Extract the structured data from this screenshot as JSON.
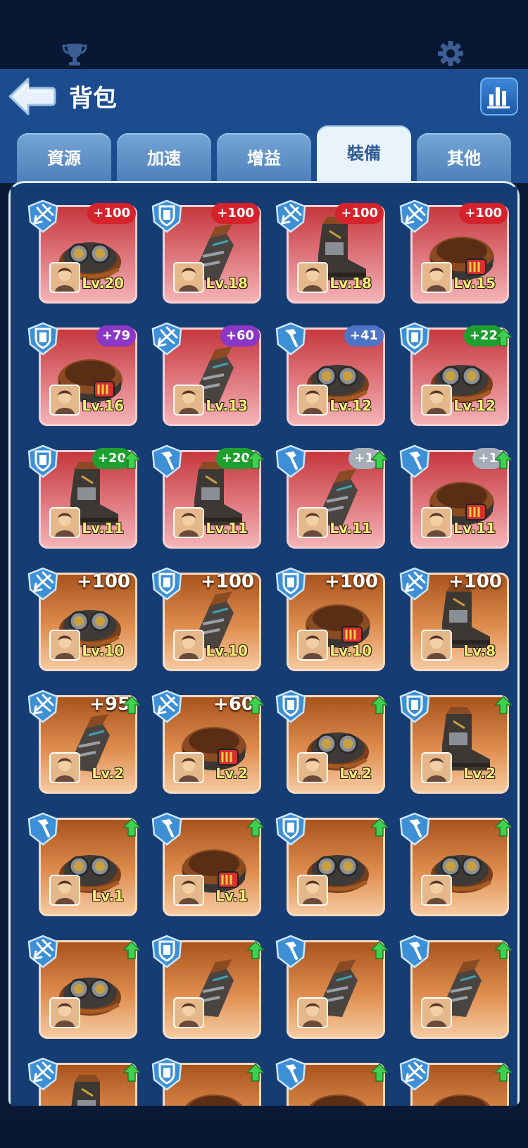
{
  "header": {
    "title": "背包"
  },
  "tabs": [
    {
      "label": "資源",
      "active": false
    },
    {
      "label": "加速",
      "active": false
    },
    {
      "label": "增益",
      "active": false
    },
    {
      "label": "裝備",
      "active": true
    },
    {
      "label": "其他",
      "active": false
    }
  ],
  "colors": {
    "header_bg": "#1c4c8e",
    "panel_bg": "#163f78",
    "level_text": "#f5ef7a"
  },
  "items": [
    {
      "type": "crossbow-icon",
      "bonus": "+100",
      "bonus_style": "red",
      "level": "Lv.20",
      "card": "red",
      "piece": "goggles-helmet",
      "upgrade": false
    },
    {
      "type": "shield-icon",
      "bonus": "+100",
      "bonus_style": "red",
      "level": "Lv.18",
      "card": "red",
      "piece": "gauntlet",
      "upgrade": false
    },
    {
      "type": "crossbow-icon",
      "bonus": "+100",
      "bonus_style": "red",
      "level": "Lv.18",
      "card": "red",
      "piece": "boot",
      "upgrade": false
    },
    {
      "type": "crossbow-icon",
      "bonus": "+100",
      "bonus_style": "red",
      "level": "Lv.15",
      "card": "red",
      "piece": "belt",
      "upgrade": false
    },
    {
      "type": "shield-icon",
      "bonus": "+79",
      "bonus_style": "purple",
      "level": "Lv.16",
      "card": "red",
      "piece": "belt",
      "upgrade": false
    },
    {
      "type": "crossbow-icon",
      "bonus": "+60",
      "bonus_style": "purple",
      "level": "Lv.13",
      "card": "red",
      "piece": "gauntlet",
      "upgrade": false
    },
    {
      "type": "hammer-icon",
      "bonus": "+41",
      "bonus_style": "blue",
      "level": "Lv.12",
      "card": "red",
      "piece": "goggles-helmet",
      "upgrade": false
    },
    {
      "type": "shield-icon",
      "bonus": "+22",
      "bonus_style": "green",
      "level": "Lv.12",
      "card": "red",
      "piece": "goggles-helmet",
      "upgrade": true
    },
    {
      "type": "shield-icon",
      "bonus": "+20",
      "bonus_style": "green",
      "level": "Lv.11",
      "card": "red",
      "piece": "boot",
      "upgrade": true
    },
    {
      "type": "hammer-icon",
      "bonus": "+20",
      "bonus_style": "green",
      "level": "Lv.11",
      "card": "red",
      "piece": "boot",
      "upgrade": true
    },
    {
      "type": "hammer-icon",
      "bonus": "+1",
      "bonus_style": "grey",
      "level": "Lv.11",
      "card": "red",
      "piece": "gauntlet",
      "upgrade": true
    },
    {
      "type": "hammer-icon",
      "bonus": "+1",
      "bonus_style": "grey",
      "level": "Lv.11",
      "card": "red",
      "piece": "belt",
      "upgrade": true
    },
    {
      "type": "crossbow-icon",
      "bonus": "+100",
      "bonus_style": "plain",
      "level": "Lv.10",
      "card": "orange",
      "piece": "goggles-helmet",
      "upgrade": false
    },
    {
      "type": "shield-icon",
      "bonus": "+100",
      "bonus_style": "plain",
      "level": "Lv.10",
      "card": "orange",
      "piece": "gauntlet",
      "upgrade": false
    },
    {
      "type": "shield-icon",
      "bonus": "+100",
      "bonus_style": "plain",
      "level": "Lv.10",
      "card": "orange",
      "piece": "belt",
      "upgrade": false
    },
    {
      "type": "crossbow-icon",
      "bonus": "+100",
      "bonus_style": "plain",
      "level": "Lv.8",
      "card": "orange",
      "piece": "boot",
      "upgrade": false
    },
    {
      "type": "crossbow-icon",
      "bonus": "+95",
      "bonus_style": "plain",
      "level": "Lv.2",
      "card": "orange",
      "piece": "gauntlet",
      "upgrade": true
    },
    {
      "type": "crossbow-icon",
      "bonus": "+60",
      "bonus_style": "plain",
      "level": "Lv.2",
      "card": "orange",
      "piece": "belt",
      "upgrade": true
    },
    {
      "type": "shield-icon",
      "bonus": "",
      "bonus_style": "none",
      "level": "Lv.2",
      "card": "orange",
      "piece": "goggles-helmet",
      "upgrade": true
    },
    {
      "type": "shield-icon",
      "bonus": "",
      "bonus_style": "none",
      "level": "Lv.2",
      "card": "orange",
      "piece": "boot",
      "upgrade": true
    },
    {
      "type": "hammer-icon",
      "bonus": "",
      "bonus_style": "none",
      "level": "Lv.1",
      "card": "orange",
      "piece": "goggles-helmet",
      "upgrade": true
    },
    {
      "type": "hammer-icon",
      "bonus": "",
      "bonus_style": "none",
      "level": "Lv.1",
      "card": "orange",
      "piece": "belt",
      "upgrade": true
    },
    {
      "type": "shield-icon",
      "bonus": "",
      "bonus_style": "none",
      "level": "",
      "card": "orange",
      "piece": "goggles-helmet",
      "upgrade": true
    },
    {
      "type": "hammer-icon",
      "bonus": "",
      "bonus_style": "none",
      "level": "",
      "card": "orange",
      "piece": "goggles-helmet",
      "upgrade": true
    },
    {
      "type": "crossbow-icon",
      "bonus": "",
      "bonus_style": "none",
      "level": "",
      "card": "orange",
      "piece": "goggles-helmet",
      "upgrade": true
    },
    {
      "type": "shield-icon",
      "bonus": "",
      "bonus_style": "none",
      "level": "",
      "card": "orange",
      "piece": "gauntlet",
      "upgrade": true
    },
    {
      "type": "hammer-icon",
      "bonus": "",
      "bonus_style": "none",
      "level": "",
      "card": "orange",
      "piece": "gauntlet",
      "upgrade": true
    },
    {
      "type": "hammer-icon",
      "bonus": "",
      "bonus_style": "none",
      "level": "",
      "card": "orange",
      "piece": "gauntlet",
      "upgrade": true
    },
    {
      "type": "crossbow-icon",
      "bonus": "",
      "bonus_style": "none",
      "level": "",
      "card": "orange",
      "piece": "boot",
      "upgrade": true
    },
    {
      "type": "shield-icon",
      "bonus": "",
      "bonus_style": "none",
      "level": "",
      "card": "orange",
      "piece": "belt",
      "upgrade": true
    },
    {
      "type": "hammer-icon",
      "bonus": "",
      "bonus_style": "none",
      "level": "",
      "card": "orange",
      "piece": "belt",
      "upgrade": true
    },
    {
      "type": "crossbow-icon",
      "bonus": "",
      "bonus_style": "none",
      "level": "",
      "card": "orange",
      "piece": "belt",
      "upgrade": true
    }
  ]
}
